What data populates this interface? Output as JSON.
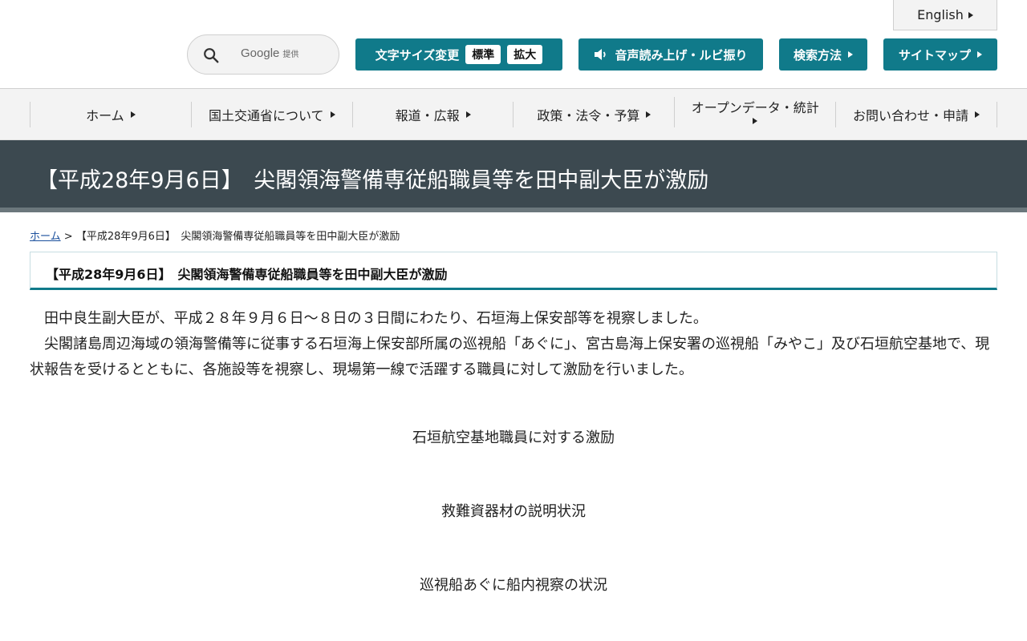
{
  "header": {
    "english_label": "English",
    "search": {
      "google_label": "Google",
      "provided_label": "提供"
    },
    "font_size": {
      "label": "文字サイズ変更",
      "standard": "標準",
      "large": "拡大"
    },
    "voice_label": "音声読み上げ・ルビ振り",
    "search_method_label": "検索方法",
    "sitemap_label": "サイトマップ"
  },
  "nav": {
    "items": [
      "ホーム",
      "国土交通省について",
      "報道・広報",
      "政策・法令・予算",
      "オープンデータ・統計",
      "お問い合わせ・申請"
    ]
  },
  "page": {
    "title": "【平成28年9月6日】　尖閣領海警備専従船職員等を田中副大臣が激励",
    "breadcrumb_home": "ホーム",
    "breadcrumb_sep": ">",
    "breadcrumb_current": "【平成28年9月6日】　尖閣領海警備専従船職員等を田中副大臣が激励",
    "heading": "【平成28年9月6日】　尖閣領海警備専従船職員等を田中副大臣が激励",
    "paragraphs": [
      "田中良生副大臣が、平成２８年９月６日～８日の３日間にわたり、石垣海上保安部等を視察しました。",
      "尖閣諸島周辺海域の領海警備等に従事する石垣海上保安部所属の巡視船「あぐに」、宮古島海上保安署の巡視船「みやこ」及び石垣航空基地で、現状報告を受けるとともに、各施設等を視察し、現場第一線で活躍する職員に対して激励を行いました。"
    ],
    "captions": [
      "石垣航空基地職員に対する激励",
      "救難資器材の説明状況",
      "巡視船あぐに船内視察の状況"
    ]
  },
  "colors": {
    "accent": "#107a8a",
    "title_band": "#3c4950",
    "nav_bg": "#f3f3f3"
  }
}
